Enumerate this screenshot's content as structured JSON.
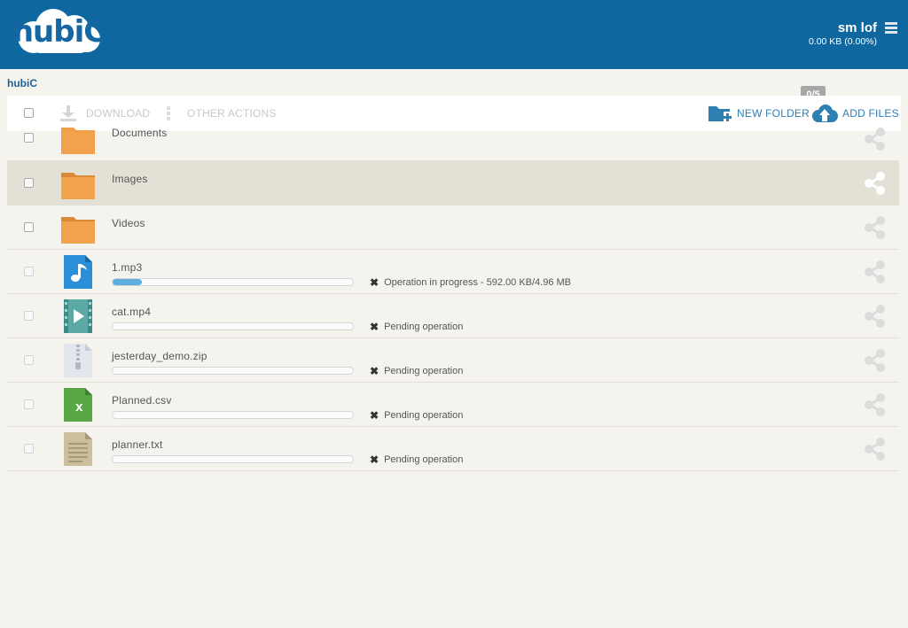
{
  "header": {
    "logo_text": "hubiC",
    "user_name": "sm lof",
    "quota": "0.00 KB (0.00%)"
  },
  "breadcrumb": "hubiC",
  "toolbar": {
    "download_label": "DOWNLOAD",
    "other_actions_label": "OTHER ACTIONS",
    "new_folder_label": "NEW FOLDER",
    "add_files_label": "ADD FILES",
    "upload_counter": "0/5"
  },
  "files": [
    {
      "name": "Documents",
      "type": "folder"
    },
    {
      "name": "Images",
      "type": "folder"
    },
    {
      "name": "Videos",
      "type": "folder"
    },
    {
      "name": "1.mp3",
      "type": "audio",
      "status": "Operation in progress - 592.00 KB/4.96 MB",
      "progress": 0.12
    },
    {
      "name": "cat.mp4",
      "type": "video",
      "status": "Pending operation",
      "progress": 0
    },
    {
      "name": "jesterday_demo.zip",
      "type": "zip",
      "status": "Pending operation",
      "progress": 0
    },
    {
      "name": "Planned.csv",
      "type": "csv",
      "status": "Pending operation",
      "progress": 0
    },
    {
      "name": "planner.txt",
      "type": "text",
      "status": "Pending operation",
      "progress": 0
    }
  ],
  "icons": {
    "x_mark": "✖",
    "csv_letter": "X"
  },
  "colors": {
    "header_bg": "#0f67a0",
    "folder": "#f0a04b",
    "accent": "#2e7fb2",
    "progress": "#5aaee0"
  }
}
